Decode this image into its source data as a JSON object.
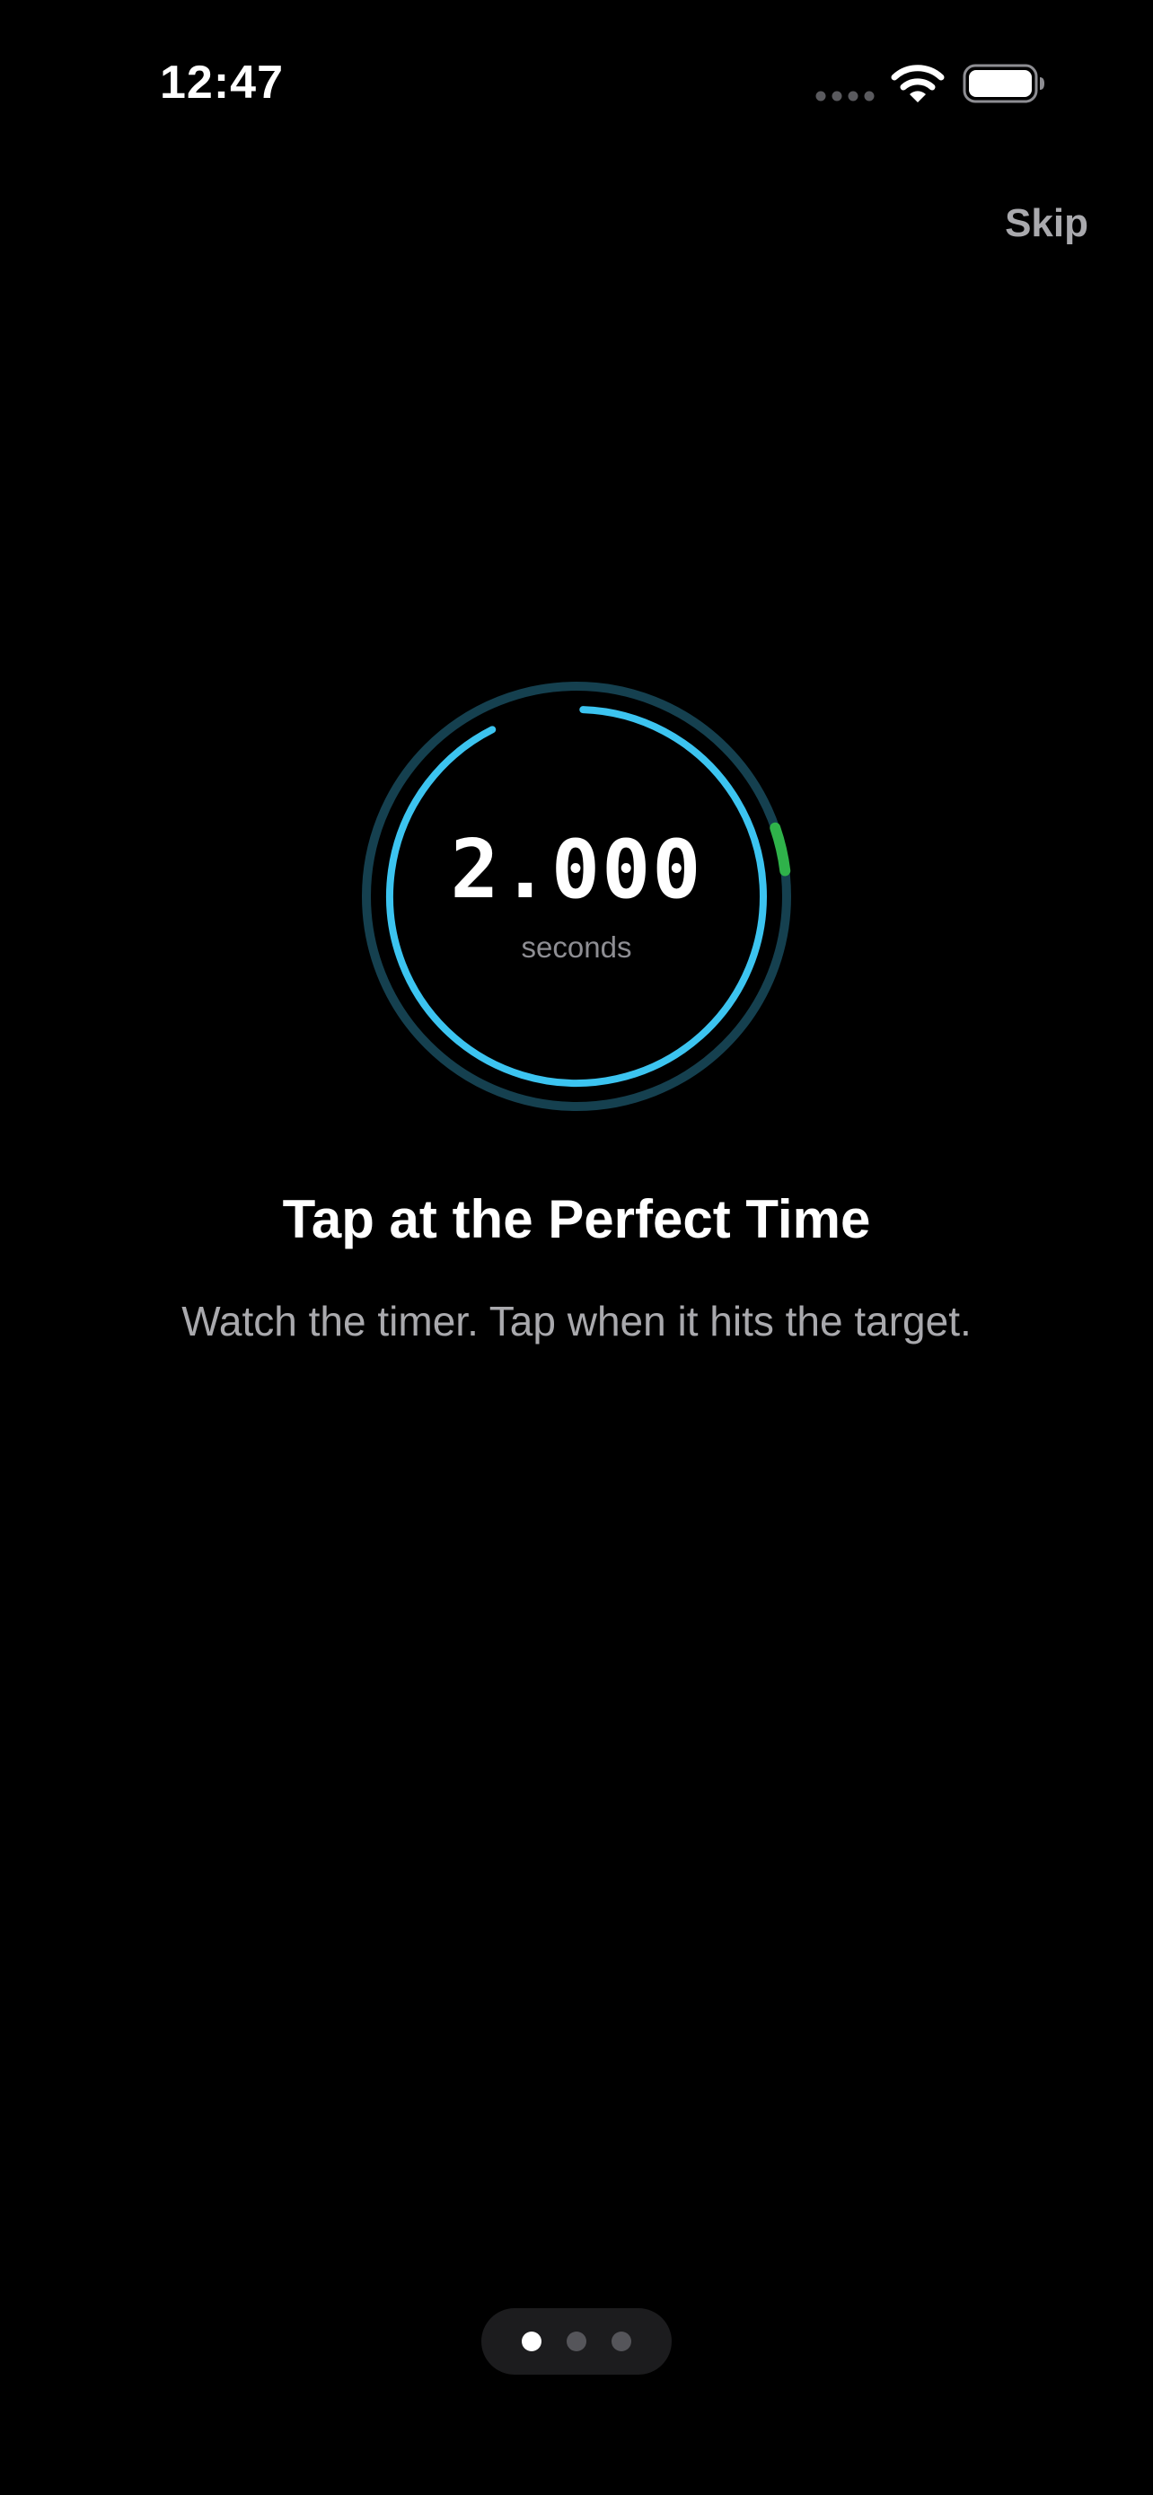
{
  "status_bar": {
    "time": "12:47",
    "signal_icon": "cellular-dots-icon",
    "wifi_icon": "wifi-icon",
    "battery_icon": "battery-icon"
  },
  "header": {
    "skip_label": "Skip"
  },
  "timer": {
    "value": "2.000",
    "unit": "seconds",
    "progress_fraction": 0.97,
    "target_marker_color": "#2fb24a",
    "progress_color": "#3cc4f0",
    "track_color": "#15404f"
  },
  "content": {
    "title": "Tap at the Perfect Time",
    "subtitle": "Watch the timer. Tap when it hits the target."
  },
  "pager": {
    "page_count": 3,
    "current_page": 1
  }
}
